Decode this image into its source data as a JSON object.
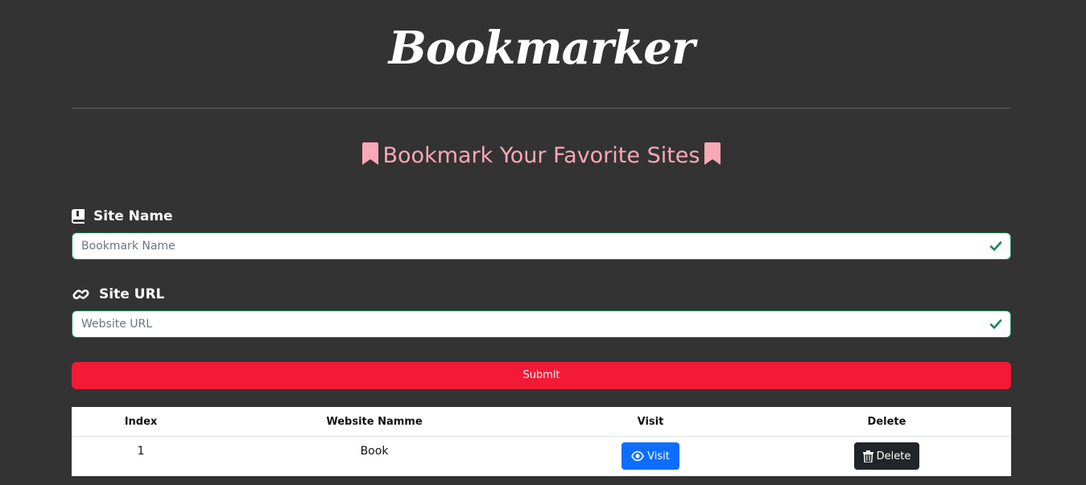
{
  "app": {
    "logo": "Bookmarker",
    "subtitle": "Bookmark Your Favorite Sites"
  },
  "form": {
    "site_name": {
      "label": "Site Name",
      "placeholder": "Bookmark Name",
      "value": "",
      "icon": "book-icon",
      "status_icon": "check-icon"
    },
    "site_url": {
      "label": "Site URL",
      "placeholder": "Website URL",
      "value": "",
      "icon": "link-icon",
      "status_icon": "check-icon"
    },
    "submit_label": "Submit"
  },
  "table": {
    "headers": [
      "Index",
      "Website Namme",
      "Visit",
      "Delete"
    ],
    "rows": [
      {
        "index": "1",
        "name": "Book",
        "visit_label": "Visit",
        "delete_label": "Delete"
      }
    ]
  },
  "colors": {
    "background": "#333333",
    "subtitle": "#f9a8b8",
    "valid_border": "#198754",
    "submit": "#f31a35",
    "visit": "#0d6efd",
    "delete": "#212529"
  }
}
